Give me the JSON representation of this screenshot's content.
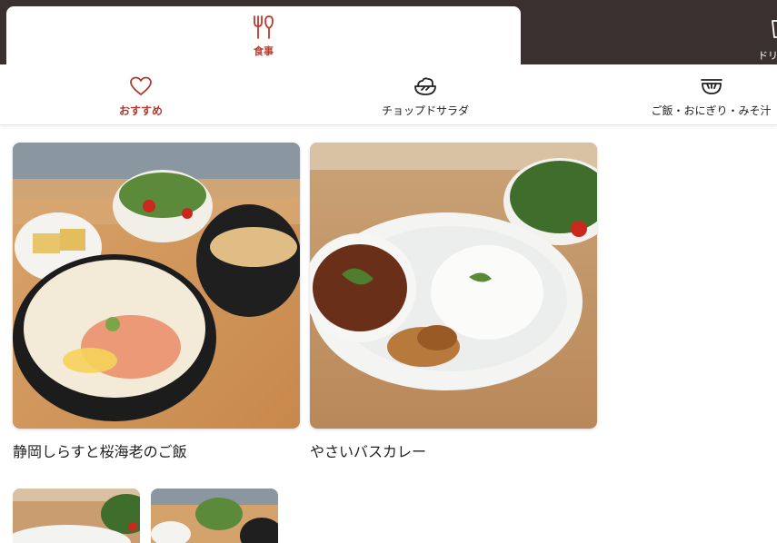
{
  "top_tabs": [
    {
      "label": "食事",
      "icon": "fork-knife-icon",
      "active": true
    },
    {
      "label": "ドリ",
      "icon": "cup-icon",
      "active": false
    }
  ],
  "categories": [
    {
      "label": "おすすめ",
      "icon": "heart-icon",
      "active": true
    },
    {
      "label": "チョップドサラダ",
      "icon": "salad-bowl-icon",
      "active": false
    },
    {
      "label": "ご飯・おにぎり・みそ汁",
      "icon": "rice-bowl-icon",
      "active": false
    }
  ],
  "menu_items": [
    {
      "name": "静岡しらすと桜海老のご飯",
      "image": "shirasu-sakura-ebi-rice-set-photo"
    },
    {
      "name": "やさいバスカレー",
      "image": "vegetable-curry-plate-photo"
    }
  ],
  "colors": {
    "header_bg": "#3a3030",
    "accent": "#b03a2e",
    "text": "#222222"
  }
}
